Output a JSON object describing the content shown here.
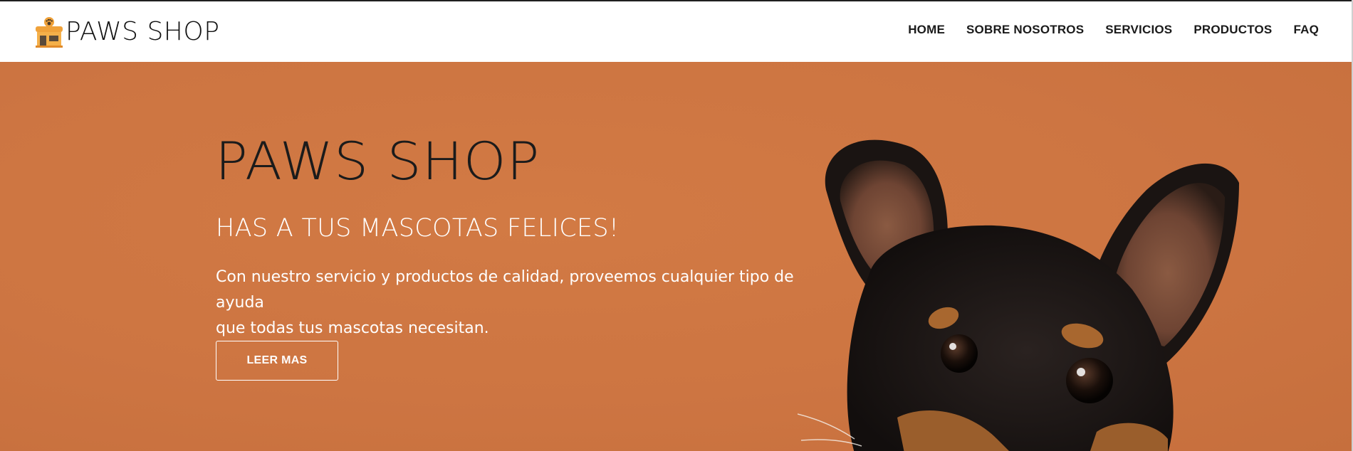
{
  "brand": {
    "name": "PAWS SHOP",
    "logo_icon": "pet-shop-icon"
  },
  "nav": {
    "items": [
      {
        "label": "HOME"
      },
      {
        "label": "SOBRE NOSOTROS"
      },
      {
        "label": "SERVICIOS"
      },
      {
        "label": "PRODUCTOS"
      },
      {
        "label": "FAQ"
      }
    ]
  },
  "hero": {
    "title": "PAWS SHOP",
    "subtitle": "HAS A TUS MASCOTAS FELICES!",
    "description_line1": "Con nuestro servicio y productos de calidad, proveemos cualquier tipo de ayuda",
    "description_line2": "que todas tus mascotas necesitan.",
    "button_label": "LEER MAS",
    "image": "dog-photo"
  },
  "colors": {
    "hero_background": "#cd7542",
    "logo_orange": "#f0a23a",
    "text_dark": "#1b1b1b",
    "text_light": "#ffffff"
  }
}
